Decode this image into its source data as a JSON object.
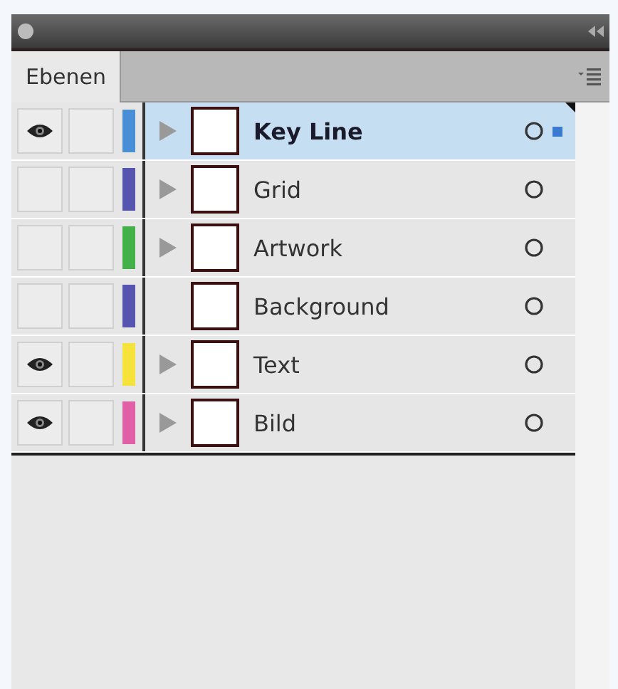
{
  "panel": {
    "tab": {
      "label": "Ebenen",
      "selected": true
    }
  },
  "layers": [
    {
      "name": "Key Line",
      "visible": true,
      "color": "#4a8fd6",
      "expandable": true,
      "selected": true
    },
    {
      "name": "Grid",
      "visible": false,
      "color": "#5555b0",
      "expandable": true,
      "selected": false
    },
    {
      "name": "Artwork",
      "visible": false,
      "color": "#44b04a",
      "expandable": true,
      "selected": false
    },
    {
      "name": "Background",
      "visible": false,
      "color": "#5555b0",
      "expandable": false,
      "selected": false
    },
    {
      "name": "Text",
      "visible": true,
      "color": "#f5e23a",
      "expandable": true,
      "selected": false
    },
    {
      "name": "Bild",
      "visible": true,
      "color": "#e060a8",
      "expandable": true,
      "selected": false
    }
  ]
}
